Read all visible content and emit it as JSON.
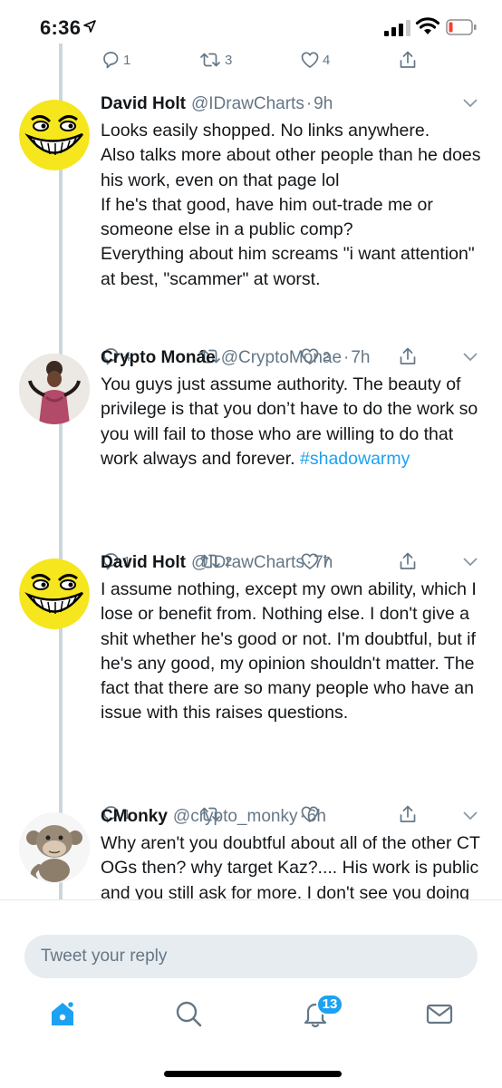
{
  "status_bar": {
    "time": "6:36"
  },
  "top_actions": {
    "reply_count": "1",
    "retweet_count": "3",
    "like_count": "4"
  },
  "tweets": [
    {
      "name": "David Holt",
      "handle": "@IDrawCharts",
      "separator": "·",
      "time": "9h",
      "text": "Looks easily shopped. No links anywhere.\nAlso talks more about other people than he does his work, even on that page lol\nIf he's that good, have him out-trade me or someone else in a public comp?\nEverything about him screams \"i want attention\" at best, \"scammer\" at worst.",
      "reply_count": "4",
      "retweet_count": "",
      "like_count": "2",
      "avatar_icon": "troll-face-icon"
    },
    {
      "name": "Crypto Monáe",
      "handle": "@CryptoMonae",
      "separator": "·",
      "time": "7h",
      "text": "You guys just assume authority. The beauty of privilege is that you don’t have to do the work so you will fail to those who are willing to do that work always and forever. ",
      "hashtag": "#shadowarmy",
      "reply_count": "1",
      "retweet_count": "2",
      "like_count": "7",
      "avatar_icon": "person-photo-icon"
    },
    {
      "name": "David Holt",
      "handle": "@IDrawCharts",
      "separator": "·",
      "time": "7h",
      "text": "I assume nothing, except my own ability, which I lose or benefit from. Nothing else. I don't give a shit whether he's good or not. I'm doubtful, but if he's any good, my opinion shouldn't matter. The fact that there are so many people who have an issue with this raises questions.",
      "reply_count": "1",
      "retweet_count": "",
      "like_count": "",
      "avatar_icon": "troll-face-icon"
    },
    {
      "name": "CMonky",
      "handle": "@crypto_monky",
      "separator": "·",
      "time": "6h",
      "text": "Why aren't you doubtful about all of the other CT OGs then? why target Kaz?.... His work is public and you still ask for more. I don't see you doing this shit to anyone",
      "avatar_icon": "monkey-plush-icon"
    }
  ],
  "reply_bar": {
    "placeholder": "Tweet your reply"
  },
  "tab_bar": {
    "notifications_badge": "13"
  },
  "colors": {
    "accent": "#1da1f2",
    "secondary_text": "#657786",
    "thread_line": "#ccd6dd",
    "reply_box_bg": "#e6ecf0"
  }
}
